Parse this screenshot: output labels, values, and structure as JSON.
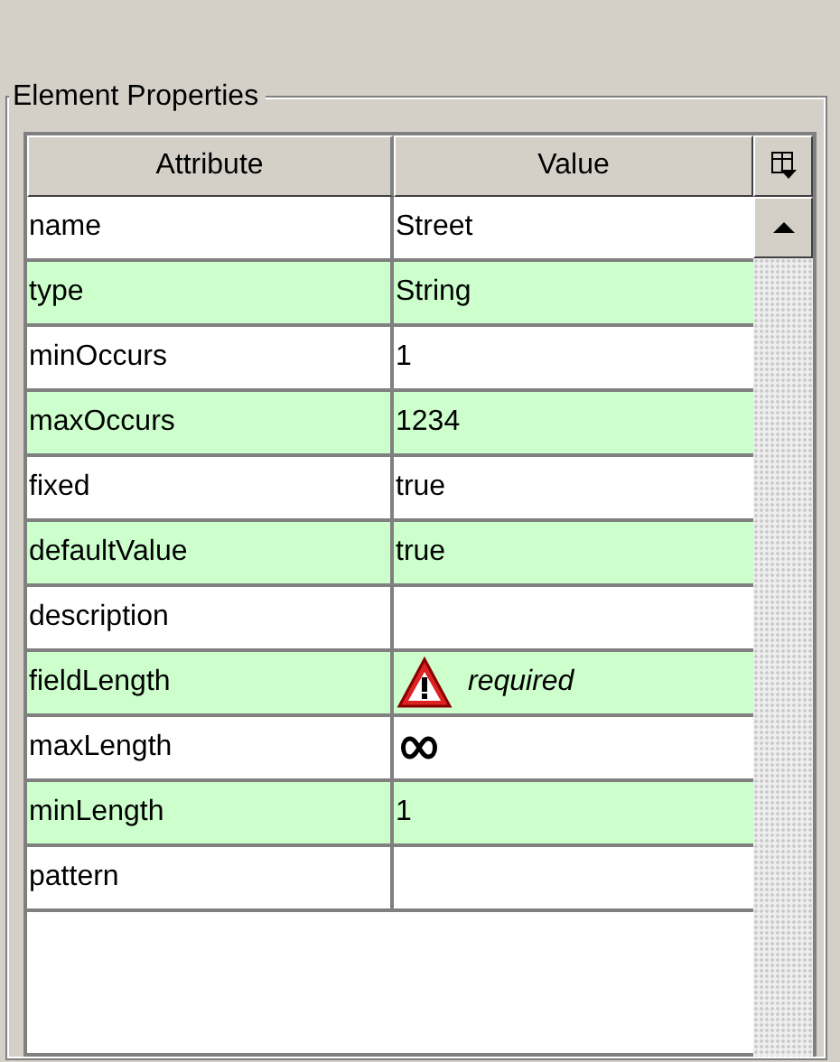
{
  "group": {
    "title": "Element Properties"
  },
  "table": {
    "columns": [
      "Attribute",
      "Value"
    ],
    "rows": [
      {
        "attribute": "name",
        "kind": "text",
        "value": "Street"
      },
      {
        "attribute": "type",
        "kind": "text",
        "value": "String"
      },
      {
        "attribute": "minOccurs",
        "kind": "text",
        "value": "1"
      },
      {
        "attribute": "maxOccurs",
        "kind": "text",
        "value": "1234"
      },
      {
        "attribute": "fixed",
        "kind": "text",
        "value": "true"
      },
      {
        "attribute": "defaultValue",
        "kind": "text",
        "value": "true"
      },
      {
        "attribute": "description",
        "kind": "empty"
      },
      {
        "attribute": "fieldLength",
        "kind": "warning",
        "value": "required"
      },
      {
        "attribute": "maxLength",
        "kind": "unbounded"
      },
      {
        "attribute": "minLength",
        "kind": "text",
        "value": "1"
      },
      {
        "attribute": "pattern",
        "kind": "empty"
      }
    ]
  }
}
